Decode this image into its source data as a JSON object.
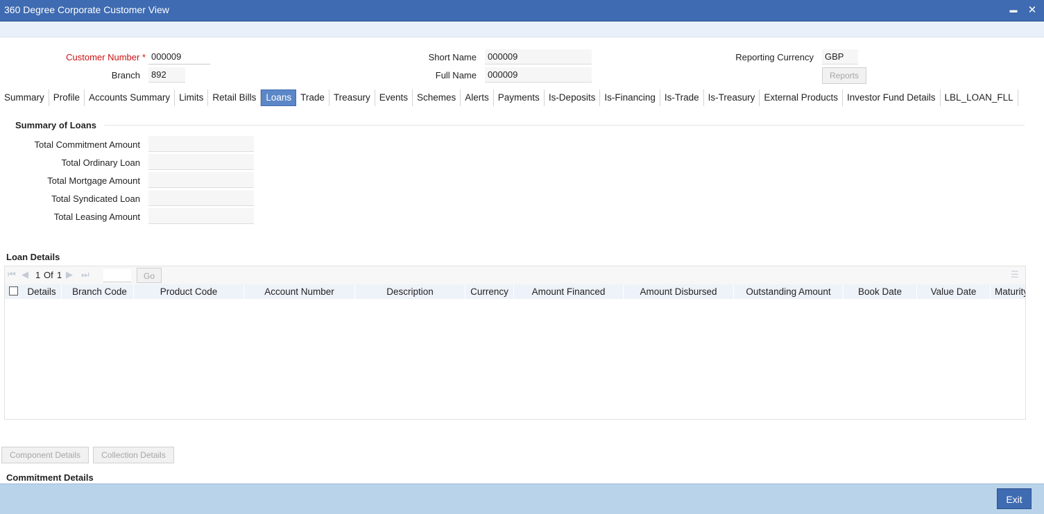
{
  "window": {
    "title": "360 Degree Corporate Customer View",
    "minimize_glyph": "▬",
    "close_glyph": "✕"
  },
  "header": {
    "customer_number_label": "Customer Number",
    "required_marker": "*",
    "customer_number": "000009",
    "branch_label": "Branch",
    "branch": "892",
    "short_name_label": "Short Name",
    "short_name": "000009",
    "full_name_label": "Full Name",
    "full_name": "000009",
    "reporting_currency_label": "Reporting Currency",
    "reporting_currency": "GBP",
    "reports_button": "Reports"
  },
  "tabs": [
    "Summary",
    "Profile",
    "Accounts Summary",
    "Limits",
    "Retail Bills",
    "Loans",
    "Trade",
    "Treasury",
    "Events",
    "Schemes",
    "Alerts",
    "Payments",
    "Is-Deposits",
    "Is-Financing",
    "Is-Trade",
    "Is-Treasury",
    "External Products",
    "Investor Fund Details",
    "LBL_LOAN_FLL"
  ],
  "active_tab": "Loans",
  "summary": {
    "title": "Summary of Loans",
    "fields": [
      {
        "label": "Total Commitment Amount",
        "value": ""
      },
      {
        "label": "Total Ordinary Loan",
        "value": ""
      },
      {
        "label": "Total Mortgage Amount",
        "value": ""
      },
      {
        "label": "Total Syndicated Loan",
        "value": ""
      },
      {
        "label": "Total Leasing Amount",
        "value": ""
      }
    ]
  },
  "loan_details": {
    "title": "Loan Details",
    "pager": {
      "current": "1",
      "of_label": "Of",
      "total": "1",
      "go_label": "Go"
    },
    "columns": [
      "Details",
      "Branch Code",
      "Product Code",
      "Account Number",
      "Description",
      "Currency",
      "Amount Financed",
      "Amount Disbursed",
      "Outstanding Amount",
      "Book Date",
      "Value Date",
      "Maturity"
    ]
  },
  "buttons": {
    "component_details": "Component Details",
    "collection_details": "Collection Details"
  },
  "commitment_title": "Commitment Details",
  "footer": {
    "exit": "Exit"
  }
}
